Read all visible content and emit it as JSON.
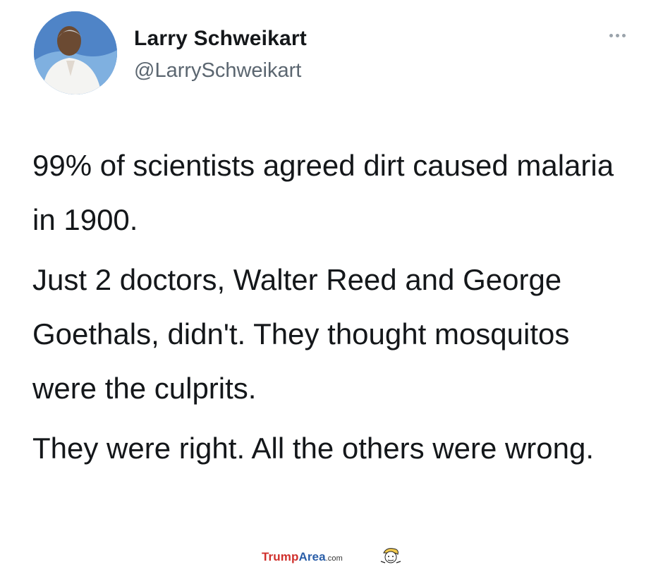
{
  "tweet": {
    "author_name": "Larry Schweikart",
    "author_handle": "@LarrySchweikart",
    "more_icon": "ellipsis-icon",
    "paragraphs": [
      "99% of scientists agreed dirt caused malaria in 1900.",
      "Just 2 doctors, Walter Reed and George Goethals, didn't. They thought mosquitos were the culprits.",
      "They were right. All the others were wrong."
    ]
  },
  "footer": {
    "brand_part1": "Trump",
    "brand_part2": "Area",
    "brand_part3": ".com",
    "brand_colors": {
      "trump": "#d0302c",
      "area": "#2a5ea8"
    }
  }
}
